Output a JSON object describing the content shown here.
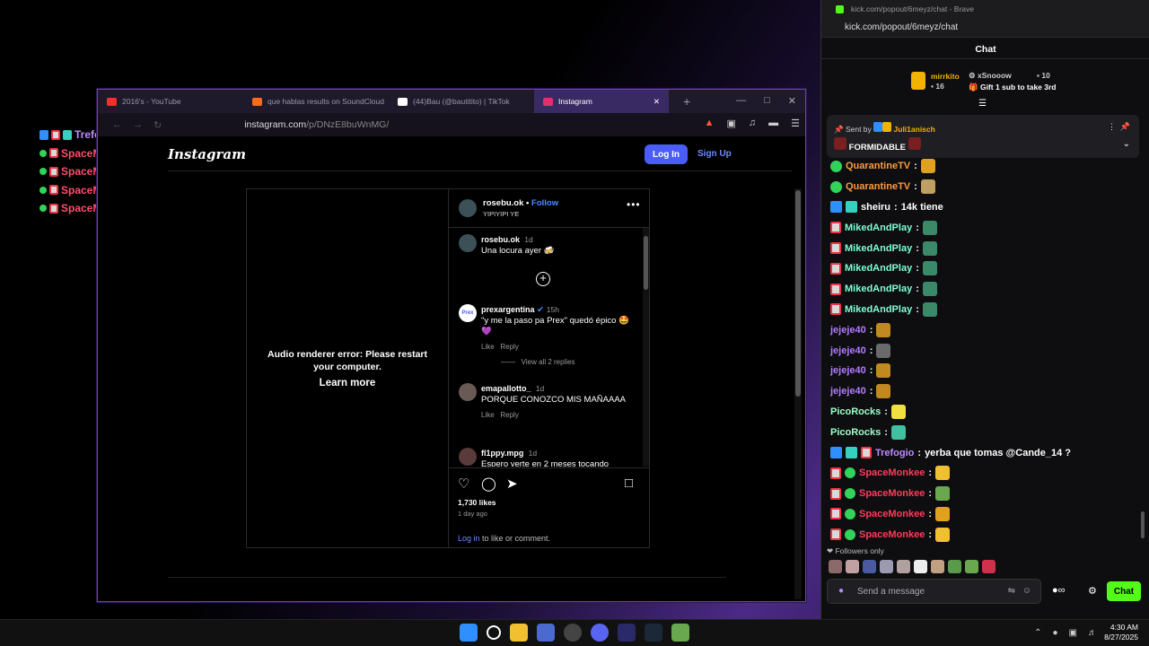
{
  "overlay_chat": [
    {
      "name": "Trefogio",
      "text": "yerba que tomas @Cande_14 ?",
      "color": "#c08bff"
    },
    {
      "name": "SpaceMonkee",
      "text": "",
      "color": "#ff4d6d"
    },
    {
      "name": "SpaceMonkee",
      "text": "",
      "color": "#ff4d6d"
    },
    {
      "name": "SpaceMonkee",
      "text": "",
      "color": "#ff4d6d"
    },
    {
      "name": "SpaceMonkee",
      "text": "",
      "color": "#ff4d6d"
    }
  ],
  "browser": {
    "tabs": [
      {
        "label": "2016's - YouTube",
        "icon": "youtube-icon",
        "color": "#ff2a2a"
      },
      {
        "label": "que hablas results on SoundCloud",
        "icon": "soundcloud-icon",
        "color": "#ff6a1a"
      },
      {
        "label": "(44)Bau (@bautitito) | TikTok",
        "icon": "tiktok-icon",
        "color": "#ffffff"
      },
      {
        "label": "Instagram",
        "icon": "instagram-icon",
        "color": "#e1306c"
      }
    ],
    "url_host": "instagram.com",
    "url_path": "/p/DNzE8buWnMG/"
  },
  "instagram": {
    "logo": "Instagram",
    "login_label": "Log In",
    "signup_label": "Sign Up",
    "media_error": "Audio renderer error: Please restart your computer.",
    "learn_more": "Learn more",
    "author": "rosebu.ok",
    "follow": "Follow",
    "author_sub": "YIPIYIPI YE",
    "comments": [
      {
        "user": "rosebu.ok",
        "time": "1d",
        "text": "Una locura ayer 🍻"
      },
      {
        "user": "prexargentina",
        "time": "15h",
        "text": "\"y me la paso pa Prex\" quedó épico 🤩 💜",
        "like": "Like",
        "reply": "Reply",
        "view": "View all 2 replies"
      },
      {
        "user": "emapallotto_",
        "time": "1d",
        "text": "PORQUE CONOZCO MIS MAÑAAAA",
        "like": "Like",
        "reply": "Reply"
      },
      {
        "user": "fl1ppy.mpg",
        "time": "1d",
        "text": "Espero verte en 2 meses tocando"
      }
    ],
    "likes": "1,730 likes",
    "ago": "1 day ago",
    "login_link": "Log in",
    "login_rest": " to like or comment."
  },
  "chat_window": {
    "title": "kick.com/popout/6meyz/chat - Brave",
    "url": "kick.com/popout/6meyz/chat",
    "header": "Chat",
    "leader1": "mirrkito",
    "leader1_count": "16",
    "leader2": "xSnooow",
    "leader2_count": "10",
    "gift": "Gift 1 sub to take 3rd",
    "pinned_by_label": "Sent by",
    "pinned_by": "Juli1anisch",
    "pinned_text": "FORMIDABLE",
    "messages": [
      {
        "name": "QuarantineTV",
        "color": "#ff9a3d",
        "text": ""
      },
      {
        "name": "QuarantineTV",
        "color": "#ff9a3d",
        "text": ""
      },
      {
        "name": "sheiru",
        "color": "#ffffff",
        "text": "14k tiene"
      },
      {
        "name": "MikedAndPlay",
        "color": "#7fffd4",
        "text": ""
      },
      {
        "name": "MikedAndPlay",
        "color": "#7fffd4",
        "text": ""
      },
      {
        "name": "MikedAndPlay",
        "color": "#7fffd4",
        "text": ""
      },
      {
        "name": "MikedAndPlay",
        "color": "#7fffd4",
        "text": ""
      },
      {
        "name": "MikedAndPlay",
        "color": "#7fffd4",
        "text": ""
      },
      {
        "name": "jejeje40",
        "color": "#b27bff",
        "text": ""
      },
      {
        "name": "jejeje40",
        "color": "#b27bff",
        "text": ""
      },
      {
        "name": "jejeje40",
        "color": "#b27bff",
        "text": ""
      },
      {
        "name": "jejeje40",
        "color": "#b27bff",
        "text": ""
      },
      {
        "name": "PicoRocks",
        "color": "#9affc8",
        "text": ""
      },
      {
        "name": "PicoRocks",
        "color": "#9affc8",
        "text": ""
      },
      {
        "name": "Trefogio",
        "color": "#c08bff",
        "text": "yerba que tomas @Cande_14 ?"
      },
      {
        "name": "SpaceMonkee",
        "color": "#ff3b5c",
        "text": ""
      },
      {
        "name": "SpaceMonkee",
        "color": "#ff3b5c",
        "text": ""
      },
      {
        "name": "SpaceMonkee",
        "color": "#ff3b5c",
        "text": ""
      },
      {
        "name": "SpaceMonkee",
        "color": "#ff3b5c",
        "text": ""
      }
    ],
    "followers_only": "Followers only",
    "input_placeholder": "Send a message",
    "chat_button": "Chat"
  },
  "taskbar": {
    "time": "4:30 AM",
    "date": "8/27/2025"
  }
}
